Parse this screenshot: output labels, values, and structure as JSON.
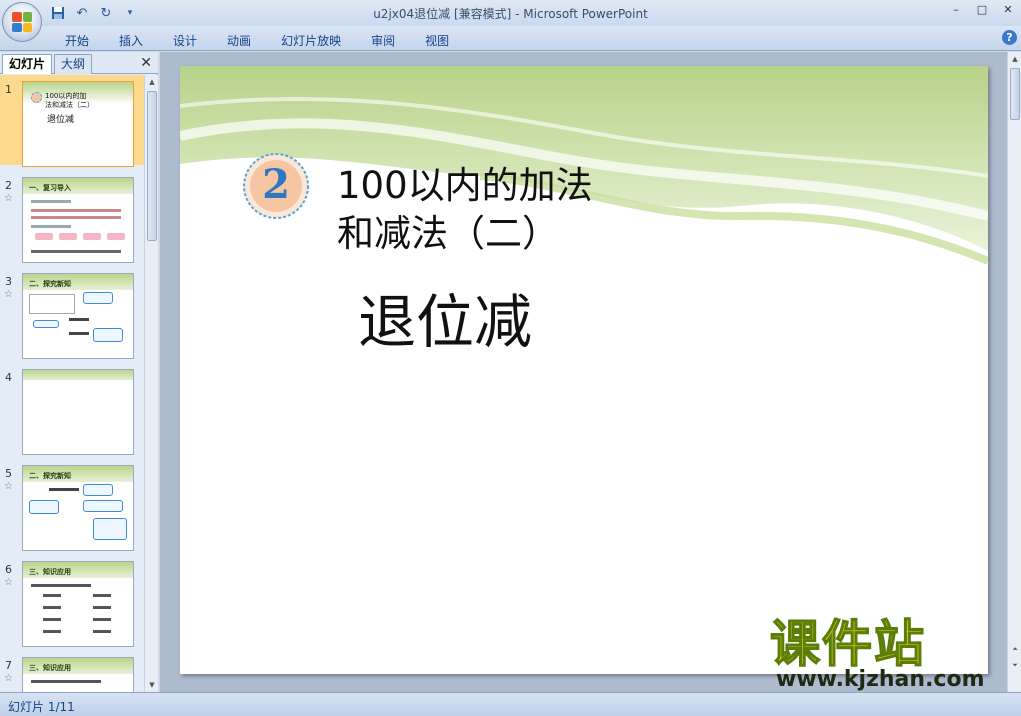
{
  "window": {
    "title": "u2jx04退位减 [兼容模式] - Microsoft PowerPoint",
    "controls": [
      "–",
      "□",
      "✕"
    ]
  },
  "qat": {
    "save_icon": "save-icon",
    "undo_icon": "undo-icon",
    "redo_icon": "redo-icon",
    "customize_icon": "customize-qat-icon"
  },
  "ribbon": {
    "tabs": [
      "开始",
      "插入",
      "设计",
      "动画",
      "幻灯片放映",
      "审阅",
      "视图"
    ],
    "help": "?"
  },
  "panel": {
    "tabs": [
      "幻灯片",
      "大纲"
    ],
    "close": "✕",
    "slides": [
      {
        "num": "1",
        "star": "",
        "title": "100以内的加法和减法（二）",
        "sub": "退位减"
      },
      {
        "num": "2",
        "star": "☆",
        "title": "一、复习导入"
      },
      {
        "num": "3",
        "star": "☆",
        "title": "二、探究新知"
      },
      {
        "num": "4",
        "star": "",
        "title": ""
      },
      {
        "num": "5",
        "star": "☆",
        "title": "二、探究新知"
      },
      {
        "num": "6",
        "star": "☆",
        "title": "三、知识应用"
      },
      {
        "num": "7",
        "star": "☆",
        "title": "三、知识应用"
      }
    ]
  },
  "slide": {
    "badge_number": "2",
    "title": "100以内的加法\n和减法（二）",
    "subtitle": "退位减",
    "colors": {
      "wave": "#b7d389",
      "badge_fill": "#f6c6a4",
      "badge_border": "#5aa3d6",
      "badge_number": "#2d78c2"
    }
  },
  "status": {
    "text": "幻灯片 1/11"
  },
  "watermark": {
    "title": "课件站",
    "url": "www.kjzhan.com"
  }
}
